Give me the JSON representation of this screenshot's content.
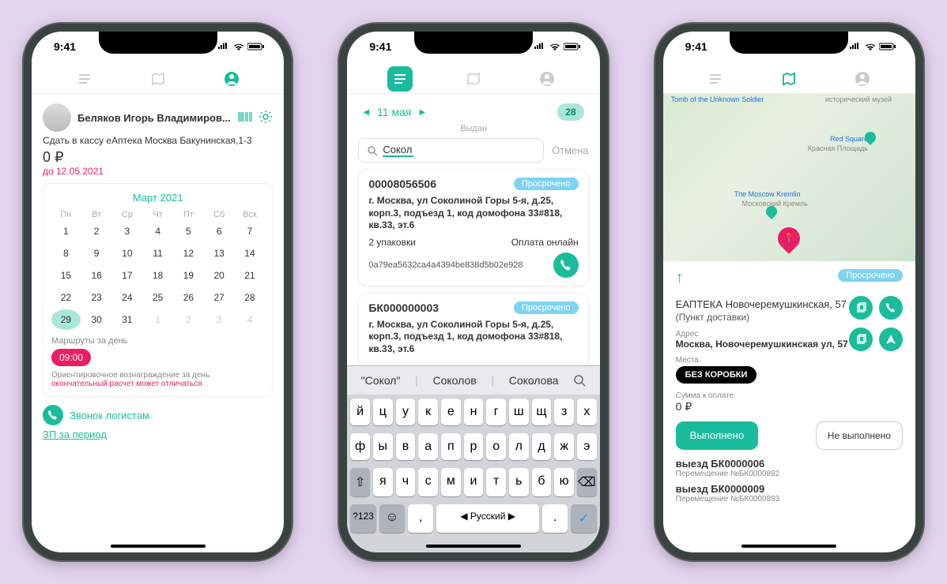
{
  "status_bar": {
    "time": "9:41"
  },
  "screen1": {
    "user_name": "Беляков Игорь Владимиров...",
    "subtext": "Сдать в кассу еАптека Москва Бакунинская,1-3",
    "price": "0 ₽",
    "until": "до 12.05.2021",
    "cal_title": "Март 2021",
    "weekdays": [
      "Пн",
      "Вт",
      "Ср",
      "Чт",
      "Пт",
      "Сб",
      "Вск"
    ],
    "days": [
      {
        "n": "1"
      },
      {
        "n": "2"
      },
      {
        "n": "3"
      },
      {
        "n": "4"
      },
      {
        "n": "5"
      },
      {
        "n": "6"
      },
      {
        "n": "7"
      },
      {
        "n": "8"
      },
      {
        "n": "9"
      },
      {
        "n": "10"
      },
      {
        "n": "11"
      },
      {
        "n": "12"
      },
      {
        "n": "13"
      },
      {
        "n": "14"
      },
      {
        "n": "15"
      },
      {
        "n": "16"
      },
      {
        "n": "17"
      },
      {
        "n": "18"
      },
      {
        "n": "19"
      },
      {
        "n": "20"
      },
      {
        "n": "21"
      },
      {
        "n": "22"
      },
      {
        "n": "23"
      },
      {
        "n": "24"
      },
      {
        "n": "25"
      },
      {
        "n": "26"
      },
      {
        "n": "27"
      },
      {
        "n": "28"
      },
      {
        "n": "29",
        "today": true
      },
      {
        "n": "30"
      },
      {
        "n": "31"
      },
      {
        "n": "1",
        "muted": true
      },
      {
        "n": "2",
        "muted": true
      },
      {
        "n": "3",
        "muted": true
      },
      {
        "n": "4",
        "muted": true
      }
    ],
    "routes_label": "Маршруты за день",
    "time_pill": "09:00",
    "note1": "Ориентировочное вознаграждение за день",
    "note2": "окончательный расчет может отличаться",
    "call_label": "Звонок логистам",
    "salary_link": "ЗП за период"
  },
  "screen2": {
    "date": "11 мая",
    "count": "28",
    "status": "Выдан",
    "search_value": "Сокол",
    "cancel": "Отмена",
    "orders": [
      {
        "id": "00008056506",
        "badge": "Просрочено",
        "addr": "г. Москва, ул Соколиной Горы 5-я, д.25, корп.3, подъезд 1, код домофона 33#818, кв.33, эт.6",
        "qty": "2 упаковки",
        "pay": "Оплата онлайн",
        "hash": "0a79ea5632ca4a4394be838d5b02e928"
      },
      {
        "id": "БК000000003",
        "badge": "Просрочено",
        "addr": "г. Москва, ул Соколиной Горы 5-я, д.25, корп.3, подъезд 1, код домофона 33#818, кв.33, эт.6"
      }
    ],
    "suggestions": [
      "\"Сокол\"",
      "Соколов",
      "Соколова"
    ],
    "kb_rows": [
      [
        "й",
        "ц",
        "у",
        "к",
        "е",
        "н",
        "г",
        "ш",
        "щ",
        "з",
        "х"
      ],
      [
        "ф",
        "ы",
        "в",
        "а",
        "п",
        "р",
        "о",
        "л",
        "д",
        "ж",
        "э"
      ],
      [
        "я",
        "ч",
        "с",
        "м",
        "и",
        "т",
        "ь",
        "б",
        "ю"
      ]
    ],
    "kb_123": "?123",
    "kb_lang": "Русский"
  },
  "screen3": {
    "map_labels": {
      "tomb": "Tomb of the Unknown Soldier",
      "red_square": "Red Square",
      "red_square_ru": "Красная Площадь",
      "kremlin": "The Moscow Kremlin",
      "kremlin_ru": "Московский Кремль",
      "museum": "исторический музей"
    },
    "badge": "Просрочено",
    "title": "ЕАПТЕКА Новочеремушкинская, 57",
    "subtitle": "(Пункт доставки)",
    "addr_label": "Адрес",
    "addr": "Москва, Новочеремушкинская ул, 57",
    "place_label": "Места",
    "place_value": "БЕЗ КОРОБКИ",
    "sum_label": "Сумма к оплате",
    "sum_value": "0 ₽",
    "btn_done": "Выполнено",
    "btn_not": "Не выполнено",
    "trips": [
      {
        "title": "выезд БК0000006",
        "sub": "Перемещение №БК0000892"
      },
      {
        "title": "выезд БК0000009",
        "sub": "Перемещение №БК0000893"
      }
    ]
  }
}
